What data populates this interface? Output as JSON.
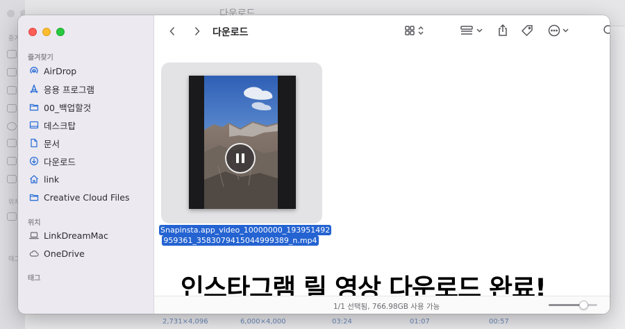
{
  "background": {
    "title": "다운로드",
    "sidebar_labels": [
      "즐겨",
      "위치",
      "태그"
    ],
    "bottom_row": [
      "2,731×4,096",
      "6,000×4,000",
      "03:24",
      "01:07",
      "00:57"
    ]
  },
  "window": {
    "title": "다운로드",
    "colors": {
      "selection": "#2463d1",
      "close": "#ff5f57",
      "minimize": "#febc2e",
      "zoom": "#28c840"
    }
  },
  "sidebar": {
    "favorites_label": "즐겨찾기",
    "favorites": [
      {
        "label": "AirDrop",
        "icon": "airdrop-icon"
      },
      {
        "label": "응용 프로그램",
        "icon": "applications-icon"
      },
      {
        "label": "00_백업할것",
        "icon": "folder-icon"
      },
      {
        "label": "데스크탑",
        "icon": "desktop-icon"
      },
      {
        "label": "문서",
        "icon": "document-icon"
      },
      {
        "label": "다운로드",
        "icon": "download-icon"
      },
      {
        "label": "link",
        "icon": "home-icon"
      },
      {
        "label": "Creative Cloud Files",
        "icon": "folder-icon"
      }
    ],
    "locations_label": "위치",
    "locations": [
      {
        "label": "LinkDreamMac",
        "icon": "laptop-icon"
      },
      {
        "label": "OneDrive",
        "icon": "cloud-icon"
      }
    ],
    "tags_label": "태그"
  },
  "content": {
    "file": {
      "name_line1": "Snapinsta.app_video_10000000_193951492",
      "name_line2": "959361_3583079415044999389_n.mp4"
    },
    "caption": "인스타그램 릴 영상 다운로드 완료!"
  },
  "status_bar": {
    "text": "1/1 선택됨, 766.98GB 사용 가능",
    "zoom_level": 0.72
  }
}
